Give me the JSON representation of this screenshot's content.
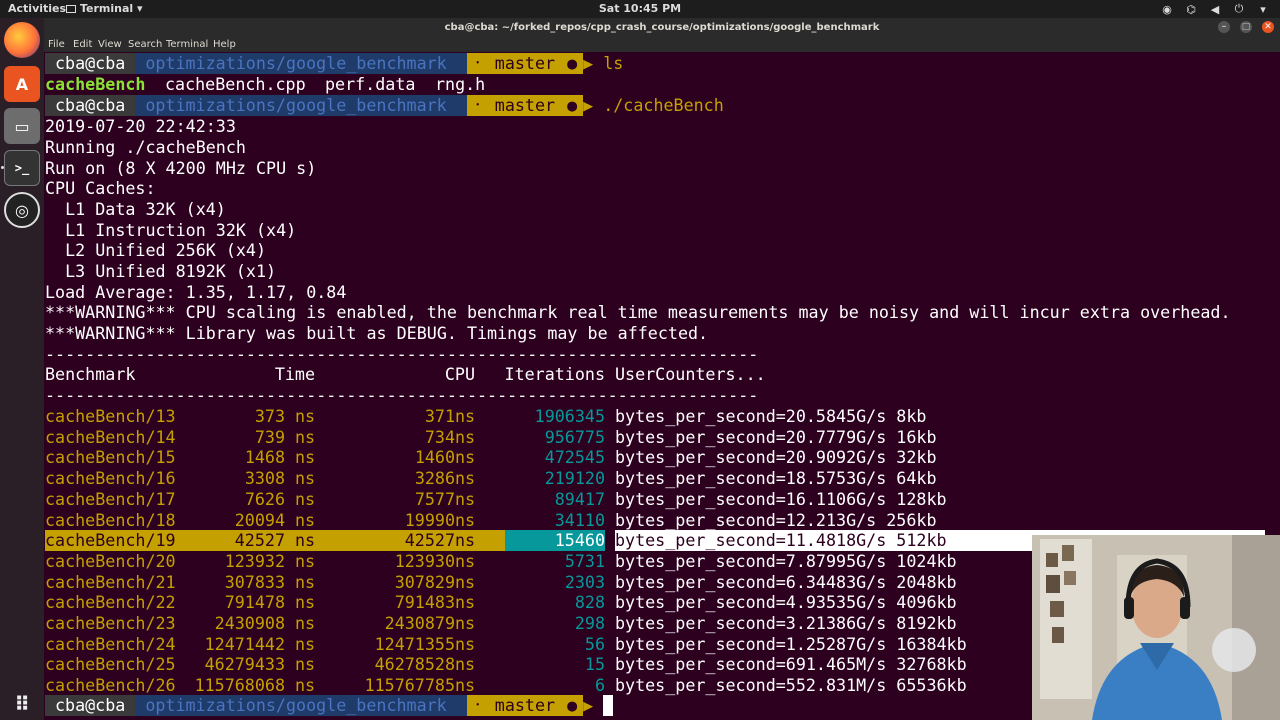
{
  "topbar": {
    "activities": "Activities",
    "app_name": "Terminal",
    "clock": "Sat 10:45 PM"
  },
  "dock": {
    "items": [
      "firefox-icon",
      "software-center-icon",
      "files-icon",
      "terminal-icon",
      "obs-icon",
      "show-apps-icon"
    ]
  },
  "window": {
    "title": "cba@cba: ~/forked_repos/cpp_crash_course/optimizations/google_benchmark",
    "menu": [
      "File",
      "Edit",
      "View",
      "Search",
      "Terminal",
      "Help"
    ]
  },
  "prompt": {
    "user": "cba@cba",
    "dir": "optimizations/google_benchmark",
    "branch": "master"
  },
  "session": {
    "cmd1": "ls",
    "ls_output": [
      "cacheBench",
      "cacheBench.cpp",
      "perf.data",
      "rng.h"
    ],
    "cmd2": "./cacheBench",
    "header_lines": [
      "2019-07-20 22:42:33",
      "Running ./cacheBench",
      "Run on (8 X 4200 MHz CPU s)",
      "CPU Caches:",
      "  L1 Data 32K (x4)",
      "  L1 Instruction 32K (x4)",
      "  L2 Unified 256K (x4)",
      "  L3 Unified 8192K (x1)",
      "Load Average: 1.35, 1.17, 0.84",
      "***WARNING*** CPU scaling is enabled, the benchmark real time measurements may be noisy and will incur extra overhead.",
      "***WARNING*** Library was built as DEBUG. Timings may be affected."
    ],
    "separator": "-----------------------------------------------------------------------",
    "columns": {
      "benchmark": "Benchmark",
      "time": "Time",
      "cpu": "CPU",
      "iterations": "Iterations",
      "counters": "UserCounters..."
    }
  },
  "table": {
    "rows": [
      {
        "name": "cacheBench/13",
        "time": "373",
        "cpu": "371",
        "unit": "ns",
        "iterations": "1906345",
        "counters": "bytes_per_second=20.5845G/s 8kb"
      },
      {
        "name": "cacheBench/14",
        "time": "739",
        "cpu": "734",
        "unit": "ns",
        "iterations": "956775",
        "counters": "bytes_per_second=20.7779G/s 16kb"
      },
      {
        "name": "cacheBench/15",
        "time": "1468",
        "cpu": "1460",
        "unit": "ns",
        "iterations": "472545",
        "counters": "bytes_per_second=20.9092G/s 32kb"
      },
      {
        "name": "cacheBench/16",
        "time": "3308",
        "cpu": "3286",
        "unit": "ns",
        "iterations": "219120",
        "counters": "bytes_per_second=18.5753G/s 64kb"
      },
      {
        "name": "cacheBench/17",
        "time": "7626",
        "cpu": "7577",
        "unit": "ns",
        "iterations": "89417",
        "counters": "bytes_per_second=16.1106G/s 128kb"
      },
      {
        "name": "cacheBench/18",
        "time": "20094",
        "cpu": "19990",
        "unit": "ns",
        "iterations": "34110",
        "counters": "bytes_per_second=12.213G/s 256kb"
      },
      {
        "name": "cacheBench/19",
        "time": "42527",
        "cpu": "42527",
        "unit": "ns",
        "iterations": "15460",
        "counters": "bytes_per_second=11.4818G/s 512kb"
      },
      {
        "name": "cacheBench/20",
        "time": "123932",
        "cpu": "123930",
        "unit": "ns",
        "iterations": "5731",
        "counters": "bytes_per_second=7.87995G/s 1024kb"
      },
      {
        "name": "cacheBench/21",
        "time": "307833",
        "cpu": "307829",
        "unit": "ns",
        "iterations": "2303",
        "counters": "bytes_per_second=6.34483G/s 2048kb"
      },
      {
        "name": "cacheBench/22",
        "time": "791478",
        "cpu": "791483",
        "unit": "ns",
        "iterations": "828",
        "counters": "bytes_per_second=4.93535G/s 4096kb"
      },
      {
        "name": "cacheBench/23",
        "time": "2430908",
        "cpu": "2430879",
        "unit": "ns",
        "iterations": "298",
        "counters": "bytes_per_second=3.21386G/s 8192kb"
      },
      {
        "name": "cacheBench/24",
        "time": "12471442",
        "cpu": "12471355",
        "unit": "ns",
        "iterations": "56",
        "counters": "bytes_per_second=1.25287G/s 16384kb"
      },
      {
        "name": "cacheBench/25",
        "time": "46279433",
        "cpu": "46278528",
        "unit": "ns",
        "iterations": "15",
        "counters": "bytes_per_second=691.465M/s 32768kb"
      },
      {
        "name": "cacheBench/26",
        "time": "115768068",
        "cpu": "115767785",
        "unit": "ns",
        "iterations": "6",
        "counters": "bytes_per_second=552.831M/s 65536kb"
      }
    ]
  },
  "colors": {
    "terminal_bg": "#2c001e",
    "accent_yellow": "#c4a000",
    "accent_cyan": "#06989a",
    "prompt_blue": "#1f3b6a"
  }
}
